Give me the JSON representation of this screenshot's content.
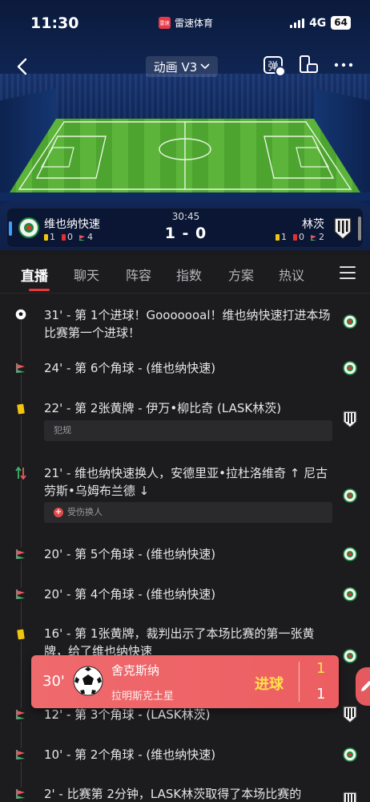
{
  "status_bar": {
    "time": "11:30",
    "app_name": "雷速体育",
    "app_logo_text": "雷速",
    "network": "4G",
    "battery": "64"
  },
  "nav": {
    "animation_mode": "动画 V3",
    "danmu_label": "弹"
  },
  "match": {
    "clock": "30:45",
    "score": "1 - 0",
    "home": {
      "name": "维也纳快速",
      "yellow": "1",
      "red": "0",
      "corners": "4"
    },
    "away": {
      "name": "林茨",
      "yellow": "1",
      "red": "0",
      "corners": "2"
    }
  },
  "tabs": [
    "直播",
    "聊天",
    "阵容",
    "指数",
    "方案",
    "热议"
  ],
  "events": [
    {
      "icon": "goal-ball-icon",
      "text": "31' - 第 1个进球！Gooooooal！维也纳快速打进本场比赛第一个进球！",
      "team": "home"
    },
    {
      "icon": "corner-flag-icon",
      "text": "24' - 第 6个角球 - (维也纳快速)",
      "team": "home"
    },
    {
      "icon": "yellow-card-icon",
      "text": "22' - 第 2张黄牌 - 伊万•柳比奇 (LASK林茨)",
      "team": "away",
      "note": "犯规"
    },
    {
      "icon": "substitution-icon",
      "text": "21' - 维也纳快速换人，安德里亚•拉杜洛维奇 ↑ 尼古劳斯•乌姆布兰德 ↓",
      "team": "home",
      "note": "受伤换人",
      "note_icon": "+"
    },
    {
      "icon": "corner-flag-icon",
      "text": "20' - 第 5个角球 - (维也纳快速)",
      "team": "home"
    },
    {
      "icon": "corner-flag-icon",
      "text": "20' - 第 4个角球 - (维也纳快速)",
      "team": "home"
    },
    {
      "icon": "yellow-card-icon",
      "text": "16' - 第 1张黄牌，裁判出示了本场比赛的第一张黄牌，给了维也纳快速",
      "team": "home"
    },
    {
      "icon": "corner-flag-icon",
      "text": "12' - 第 3个角球 - (LASK林茨)",
      "team": "away"
    },
    {
      "icon": "corner-flag-icon",
      "text": "10' - 第 2个角球 - (维也纳快速)",
      "team": "home"
    },
    {
      "icon": "corner-flag-icon",
      "text": "2' - 比赛第 2分钟，LASK林茨取得了本场比赛的",
      "team": "away"
    }
  ],
  "goal_toast": {
    "minute": "30'",
    "player": "舍克斯纳",
    "assist": "拉明斯克土星",
    "label": "进球",
    "score_top": "1",
    "score_bottom": "1"
  },
  "colors": {
    "accent_red": "#e53a3a",
    "toast_bg": "#ec5e62",
    "goal_yellow": "#ffe04a",
    "pitch_green": "#4da530"
  }
}
